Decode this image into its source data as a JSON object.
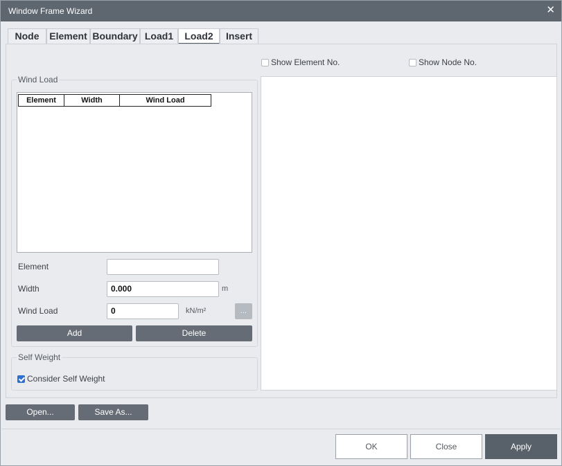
{
  "window": {
    "title": "Window Frame Wizard",
    "close_glyph": "✕"
  },
  "tabs": [
    {
      "label": "Node"
    },
    {
      "label": "Element"
    },
    {
      "label": "Boundary"
    },
    {
      "label": "Load1"
    },
    {
      "label": "Load2",
      "active": true
    },
    {
      "label": "Insert"
    }
  ],
  "wind_load": {
    "group_label": "Wind Load",
    "columns": [
      "Element",
      "Width",
      "Wind Load"
    ],
    "rows": []
  },
  "form": {
    "element_label": "Element",
    "element_value": "",
    "width_label": "Width",
    "width_value": "0.000",
    "width_unit": "m",
    "wind_label": "Wind Load",
    "wind_value": "0",
    "wind_unit": "kN/m²",
    "dots_label": "..."
  },
  "actions": {
    "add": "Add",
    "delete": "Delete"
  },
  "self_weight": {
    "group_label": "Self Weight",
    "consider_label": "Consider Self Weight",
    "checked": true
  },
  "view_options": {
    "show_element": "Show Element No.",
    "show_node": "Show Node No."
  },
  "file_buttons": {
    "open": "Open...",
    "save_as": "Save As..."
  },
  "footer": {
    "ok": "OK",
    "close": "Close",
    "apply": "Apply"
  },
  "colors": {
    "titlebar": "#5e6670",
    "dark_button": "#656c76",
    "apply": "#58606a",
    "check_accent": "#2e6fcf"
  }
}
